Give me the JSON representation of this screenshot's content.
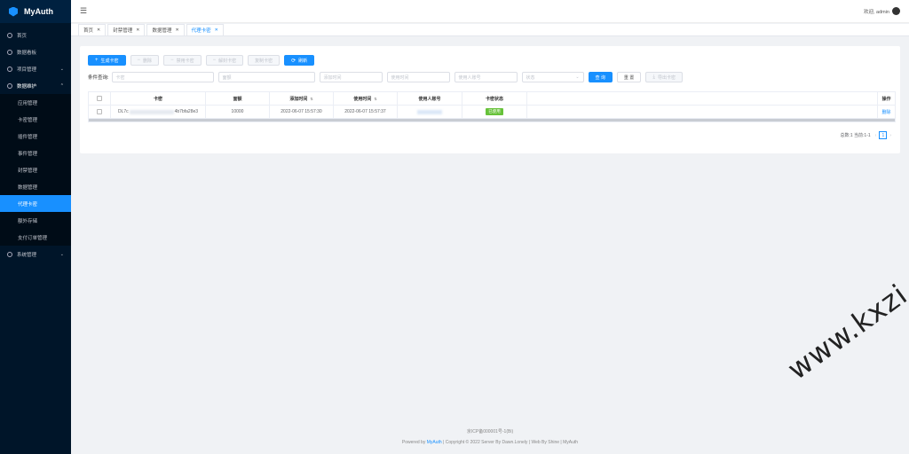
{
  "app": {
    "title": "MyAuth"
  },
  "sidebar": {
    "items": [
      {
        "label": "首页"
      },
      {
        "label": "数据看板"
      },
      {
        "label": "项目管理"
      },
      {
        "label": "数据维护"
      }
    ],
    "sub_items": [
      {
        "label": "应用管理"
      },
      {
        "label": "卡密管理"
      },
      {
        "label": "插件管理"
      },
      {
        "label": "事件管理"
      },
      {
        "label": "封禁管理"
      },
      {
        "label": "数据管理"
      },
      {
        "label": "代理卡密"
      },
      {
        "label": "额外存储"
      },
      {
        "label": "支付订单管理"
      }
    ],
    "system": {
      "label": "系统管理"
    }
  },
  "header": {
    "welcome": "欢迎, admin"
  },
  "tabs": [
    {
      "label": "首页"
    },
    {
      "label": "封禁管理"
    },
    {
      "label": "数据管理"
    },
    {
      "label": "代理卡密"
    }
  ],
  "toolbar": {
    "generate": "生成卡密",
    "delete": "删除",
    "disable": "禁用卡密",
    "unban": "解封卡密",
    "copy": "复制卡密",
    "refresh": "刷新"
  },
  "filter": {
    "label": "条件查询:",
    "card_ph": "卡密",
    "amount_ph": "面额",
    "add_time_ph": "添加时间",
    "use_time_ph": "使用时间",
    "user_ph": "使用人账号",
    "status_ph": "状态",
    "search": "查 询",
    "reset": "重 置",
    "export": "导出卡密"
  },
  "table": {
    "headers": {
      "card": "卡密",
      "amount": "面额",
      "added": "添加时间",
      "used": "使用时间",
      "user": "使用人账号",
      "status": "卡密状态",
      "ops": "操作"
    },
    "rows": [
      {
        "card_prefix": "DL7c",
        "card_suffix": "4b7bfa28e3",
        "amount": "10000",
        "added": "2022-06-07 15:57:30",
        "used": "2022-06-07 15:57:37",
        "status": "已使用",
        "op": "删除"
      }
    ]
  },
  "pager": {
    "summary": "总数:1 当前:1-1",
    "page": "1"
  },
  "footer": {
    "icp": "京ICP备000001号-1(Bi)",
    "powered_prefix": "Powered by",
    "powered_link": "MyAuth",
    "rest": "| Copyright © 2022 Server By Dawn.Lonely | Web By Shine | MyAuth"
  },
  "watermark": "www.kxzi.cn",
  "colors": {
    "primary": "#1890ff",
    "sidebar": "#001529",
    "success": "#67c23a"
  }
}
